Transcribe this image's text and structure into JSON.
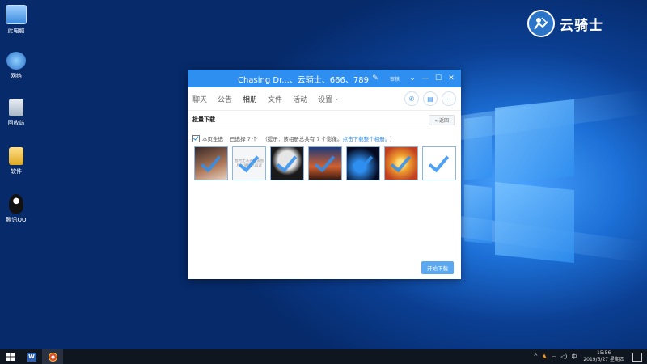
{
  "desktop": {
    "icons": [
      {
        "label": "此电脑",
        "icon": "computer-icon"
      },
      {
        "label": "网络",
        "icon": "network-icon"
      },
      {
        "label": "回收站",
        "icon": "recycle-bin-icon"
      },
      {
        "label": "软件",
        "icon": "folder-icon"
      },
      {
        "label": "腾讯QQ",
        "icon": "qq-icon"
      }
    ],
    "brand": {
      "name": "云骑士",
      "icon": "knight-logo-icon"
    }
  },
  "window": {
    "title": "Chasing Dr...、云骑士、666、789",
    "edit_icon": "pencil-icon",
    "pill": "审核",
    "controls": {
      "dropdown": "⌄",
      "minimize": "—",
      "maximize": "☐",
      "close": "✕"
    },
    "tabs": [
      "聊天",
      "公告",
      "相册",
      "文件",
      "活动",
      "设置"
    ],
    "active_tab": "相册",
    "tab_icons": [
      "phone-icon",
      "message-icon",
      "more-icon"
    ],
    "sub_header": {
      "label": "批量下载",
      "back": "返回"
    },
    "selection": {
      "select_all": "本页全选",
      "selected_count": "已选择 7 个",
      "hint": "（提示：该相册总共有 7 个影像。",
      "link": "点击下载整个相册。",
      "hint_end": "）"
    },
    "thumbnails": [
      {
        "name": "photo-1",
        "colors": [
          "#3a2a28",
          "#b07a5a"
        ]
      },
      {
        "name": "photo-2-unavailable",
        "message": "暂时无法查看该图片，请稍后再试"
      },
      {
        "name": "photo-3",
        "colors": [
          "#1a1a1a",
          "#e6e6e6"
        ]
      },
      {
        "name": "photo-4",
        "colors": [
          "#1b3a7a",
          "#d06030"
        ]
      },
      {
        "name": "photo-5",
        "colors": [
          "#050a20",
          "#2f8ff0"
        ]
      },
      {
        "name": "photo-6",
        "colors": [
          "#f0a030",
          "#c04020"
        ]
      },
      {
        "name": "photo-7",
        "colors": [
          "#ffffff",
          "#4a8ad8"
        ]
      }
    ],
    "start_download": "开始下载"
  },
  "taskbar": {
    "apps": [
      "word-icon",
      "browser-icon"
    ],
    "tray": {
      "chevron": "^",
      "ime": "中",
      "time": "15:56",
      "date": "2019/6/27 星期四"
    }
  },
  "colors": {
    "accent": "#2f8ff0",
    "taskbar": "#101620"
  }
}
